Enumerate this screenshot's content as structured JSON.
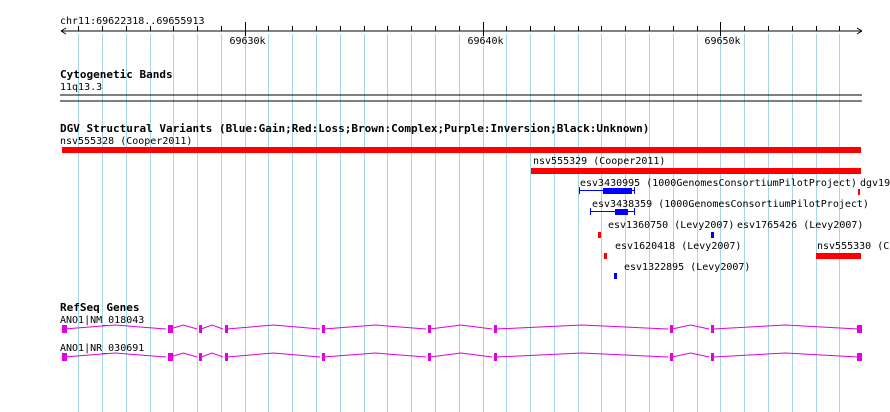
{
  "ruler": {
    "location": "chr11:69622318..69655913",
    "start": 69622318,
    "end": 69655913,
    "ticks": [
      {
        "pos": 69630000,
        "label": "69630k"
      },
      {
        "pos": 69640000,
        "label": "69640k"
      },
      {
        "pos": 69650000,
        "label": "69650k"
      }
    ]
  },
  "cytobands": {
    "title": "Cytogenetic Bands",
    "band_label": "11q13.3"
  },
  "dgv": {
    "title": "DGV Structural Variants (Blue:Gain;Red:Loss;Brown:Complex;Purple:Inversion;Black:Unknown)",
    "features": [
      {
        "label": "nsv555328 (Cooper2011)",
        "start": 69622318,
        "end": 69655913,
        "type": "loss"
      },
      {
        "label": "nsv555329 (Cooper2011)",
        "start": 69642050,
        "end": 69655913,
        "type": "loss"
      },
      {
        "label": "esv3430995 (1000GenomesConsortiumPilotProject)",
        "start": 69644050,
        "end": 69646420,
        "core_start": 69645060,
        "core_end": 69646300,
        "type": "gain"
      },
      {
        "label": "dgv19",
        "start": 69655770,
        "end": 69655860,
        "type": "loss"
      },
      {
        "label": "esv3438359 (1000GenomesConsortiumPilotProject)",
        "start": 69644520,
        "end": 69646420,
        "core_start": 69645550,
        "core_end": 69646130,
        "type": "gain"
      },
      {
        "label": "esv1360750 (Levy2007)",
        "start": 69644850,
        "end": 69644960,
        "type": "loss"
      },
      {
        "label": "esv1765426 (Levy2007)",
        "start": 69649610,
        "end": 69649720,
        "type": "gain"
      },
      {
        "label": "nsv555330 (Co",
        "start": 69654040,
        "end": 69655913,
        "type": "loss"
      },
      {
        "label": "esv1620418 (Levy2007)",
        "start": 69645110,
        "end": 69645220,
        "type": "loss"
      },
      {
        "label": "esv1322895 (Levy2007)",
        "start": 69645530,
        "end": 69645640,
        "type": "gain"
      }
    ]
  },
  "refseq": {
    "title": "RefSeq Genes",
    "transcripts": [
      {
        "label": "ANO1|NM_018043",
        "exons": [
          69622318,
          69626780,
          69628070,
          69629190,
          69633230,
          69637700,
          69640480,
          69647880,
          69649620,
          69655890
        ]
      },
      {
        "label": "ANO1|NR_030691",
        "exons": [
          69622318,
          69626780,
          69628070,
          69629190,
          69633230,
          69637700,
          69640480,
          69647880,
          69649620,
          69655890
        ]
      }
    ]
  },
  "colors": {
    "grid": "#a7d5e6",
    "gain": "#0000ff",
    "loss": "#ff0000",
    "gene": "#e000e0",
    "text": "#000000"
  }
}
